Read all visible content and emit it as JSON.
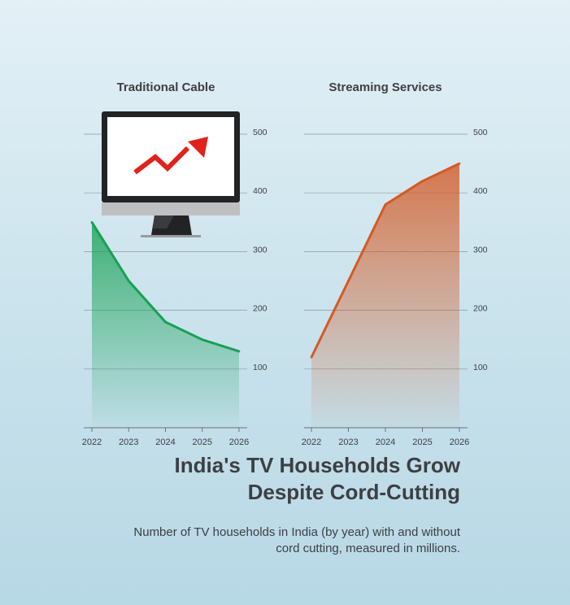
{
  "header": {
    "title_line1": "India's TV Households Grow",
    "title_line2": "Despite Cord-Cutting",
    "subtitle": "Number of TV households in India (by year) with and without cord cutting, measured in millions."
  },
  "icons": {
    "decoration": "monitor-with-rising-arrow-icon"
  },
  "colors": {
    "cable": "#16a154",
    "streaming": "#d35a24",
    "arrow": "#e0231c"
  },
  "chart_data": [
    {
      "type": "area",
      "title": "Traditional Cable",
      "x": [
        "2022",
        "2023",
        "2024",
        "2025",
        "2026"
      ],
      "series": [
        {
          "values": [
            350,
            250,
            180,
            150,
            130
          ]
        }
      ],
      "yticks": [
        100,
        200,
        300,
        400,
        500
      ],
      "ylim": [
        0,
        500
      ],
      "grid": true
    },
    {
      "type": "area",
      "title": "Streaming Services",
      "x": [
        "2022",
        "2023",
        "2024",
        "2025",
        "2026"
      ],
      "series": [
        {
          "values": [
            120,
            250,
            380,
            420,
            450
          ]
        }
      ],
      "yticks": [
        100,
        200,
        300,
        400,
        500
      ],
      "ylim": [
        0,
        500
      ],
      "grid": true
    }
  ]
}
